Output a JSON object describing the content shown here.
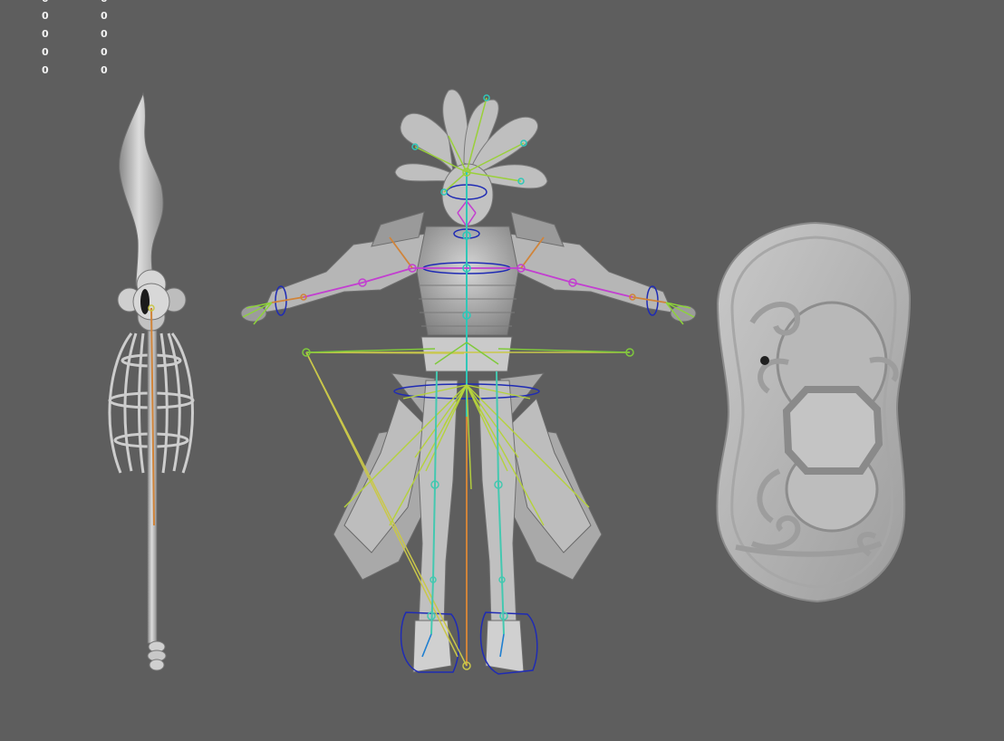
{
  "viewport": {
    "background": "#5e5e5e",
    "hud_rows": [
      {
        "col1": "0",
        "col2": "0"
      },
      {
        "col1": "0",
        "col2": "0"
      },
      {
        "col1": "0",
        "col2": "0"
      },
      {
        "col1": "0",
        "col2": "0"
      },
      {
        "col1": "0",
        "col2": "0"
      }
    ]
  },
  "scene": {
    "objects": [
      "spear-mesh",
      "warrior-character-mesh",
      "shield-mesh"
    ],
    "joint_colors": {
      "spine": "#2fc7b8",
      "legs": "#44c8b0",
      "arms_left": "#c23fd0",
      "arms_right": "#c23fd0",
      "hands": "#8ed33a",
      "skirt": "#b5d23c",
      "head": "#9ad03a",
      "control_curves": "#1f2bb4",
      "pole_vector": "#c9c74a",
      "root": "#d0843a"
    }
  }
}
